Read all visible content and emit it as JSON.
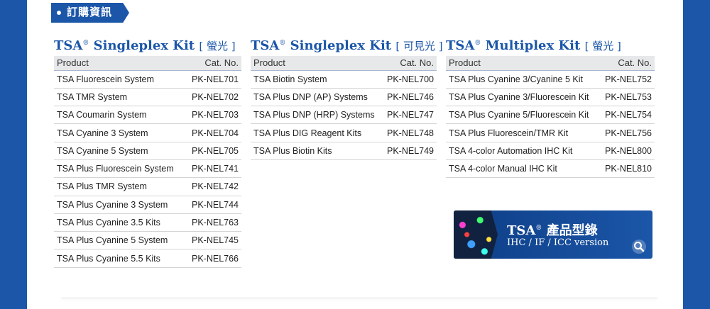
{
  "tag": "訂購資訊",
  "columns": [
    {
      "title": "TSA",
      "sup": "®",
      "name": " Singleplex Kit ",
      "suffix": "[ 螢光 ]",
      "headers": {
        "product": "Product",
        "catno": "Cat. No."
      },
      "rows": [
        {
          "product": "TSA Fluorescein System",
          "catno": "PK-NEL701"
        },
        {
          "product": "TSA TMR System",
          "catno": "PK-NEL702"
        },
        {
          "product": "TSA Coumarin System",
          "catno": "PK-NEL703"
        },
        {
          "product": "TSA Cyanine 3 System",
          "catno": "PK-NEL704"
        },
        {
          "product": "TSA Cyanine 5 System",
          "catno": "PK-NEL705"
        },
        {
          "product": "TSA Plus Fluorescein System",
          "catno": "PK-NEL741"
        },
        {
          "product": "TSA Plus TMR System",
          "catno": "PK-NEL742"
        },
        {
          "product": "TSA Plus Cyanine 3 System",
          "catno": "PK-NEL744"
        },
        {
          "product": "TSA Plus Cyanine 3.5 Kits",
          "catno": "PK-NEL763"
        },
        {
          "product": "TSA Plus Cyanine 5 System",
          "catno": "PK-NEL745"
        },
        {
          "product": "TSA Plus Cyanine 5.5 Kits",
          "catno": "PK-NEL766"
        }
      ]
    },
    {
      "title": "TSA",
      "sup": "®",
      "name": " Singleplex Kit ",
      "suffix": "[ 可見光 ]",
      "headers": {
        "product": "Product",
        "catno": "Cat. No."
      },
      "rows": [
        {
          "product": "TSA Biotin System",
          "catno": "PK-NEL700"
        },
        {
          "product": "TSA Plus DNP (AP) Systems",
          "catno": "PK-NEL746"
        },
        {
          "product": "TSA Plus DNP (HRP) Systems",
          "catno": "PK-NEL747"
        },
        {
          "product": "TSA Plus DIG Reagent Kits",
          "catno": "PK-NEL748"
        },
        {
          "product": "TSA Plus Biotin Kits",
          "catno": "PK-NEL749"
        }
      ]
    },
    {
      "title": "TSA",
      "sup": "®",
      "name": " Multiplex Kit ",
      "suffix": "[ 螢光 ]",
      "headers": {
        "product": "Product",
        "catno": "Cat. No."
      },
      "rows": [
        {
          "product": "TSA Plus Cyanine 3/Cyanine 5 Kit",
          "catno": "PK-NEL752"
        },
        {
          "product": "TSA Plus Cyanine 3/Fluorescein Kit",
          "catno": "PK-NEL753"
        },
        {
          "product": "TSA Plus Cyanine 5/Fluorescein Kit",
          "catno": "PK-NEL754"
        },
        {
          "product": "TSA Plus Fluorescein/TMR Kit",
          "catno": "PK-NEL756"
        },
        {
          "product": "TSA 4-color Automation IHC Kit",
          "catno": "PK-NEL800"
        },
        {
          "product": "TSA 4-color Manual IHC Kit",
          "catno": "PK-NEL810"
        }
      ]
    }
  ],
  "catalog": {
    "title": "TSA",
    "sup": "®",
    "title_rest": " 產品型錄",
    "subtitle": "IHC / IF / ICC version",
    "icon": "search-icon"
  },
  "colors": {
    "brand": "#1b56a8",
    "header_bg": "#e7e8ea"
  }
}
